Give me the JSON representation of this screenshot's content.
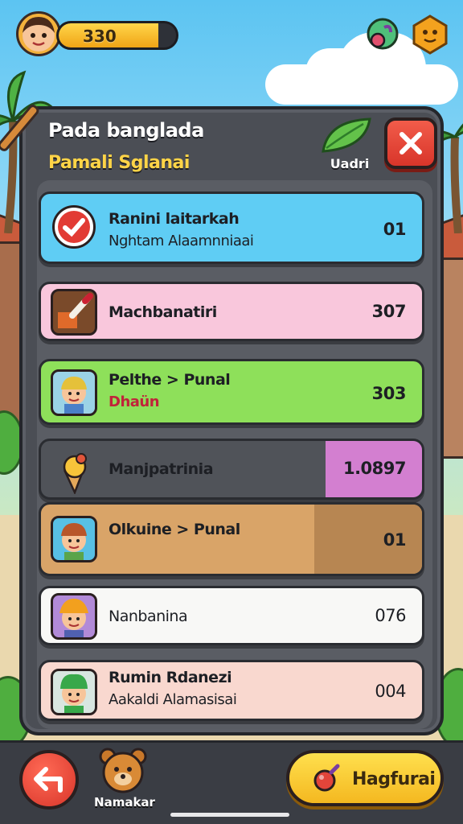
{
  "hud": {
    "coins": "330",
    "coin_progress": 0.85
  },
  "panel": {
    "title": "Pada banglada",
    "subtitle": "Pamali Sglanai",
    "leaf_label": "Uadri",
    "close_icon": "close-icon"
  },
  "rows": [
    {
      "line1": "Ranini laitarkah",
      "line2": "Nghtam Alaamnniaai",
      "value": "01",
      "color": "#5fcdf4",
      "icon": "checkmark-icon"
    },
    {
      "line1": "Machbanatiri",
      "line2": "",
      "value": "307",
      "color": "#f9c7dc",
      "icon": "paintbrush-icon"
    },
    {
      "line1": "Pelthe > Punal",
      "line2": "Dhaün",
      "value": "303",
      "color": "#8ee05a",
      "icon": "kid-avatar-icon"
    },
    {
      "line1": "Manjpatrinia",
      "line2": "",
      "value": "1.0897",
      "color": "#505359",
      "accent": "#d37fd0",
      "icon": "ice-cream-icon"
    },
    {
      "line1": "Olkuine > Punal",
      "line2": "",
      "value": "01",
      "color": "#d9a468",
      "accent": "#b78652",
      "icon": "boy-avatar-icon"
    },
    {
      "line1": "Nanbanina",
      "line2": "",
      "value": "076",
      "color": "#f8f8f6",
      "icon": "builder-avatar-icon"
    },
    {
      "line1": "Rumin Rdanezi",
      "line2": "Aakaldi Alamasisai",
      "value": "004",
      "color": "#f9d8cf",
      "icon": "green-hat-avatar-icon"
    }
  ],
  "bottom": {
    "mascot_label": "Namakar",
    "action_label": "Hagfurai"
  }
}
